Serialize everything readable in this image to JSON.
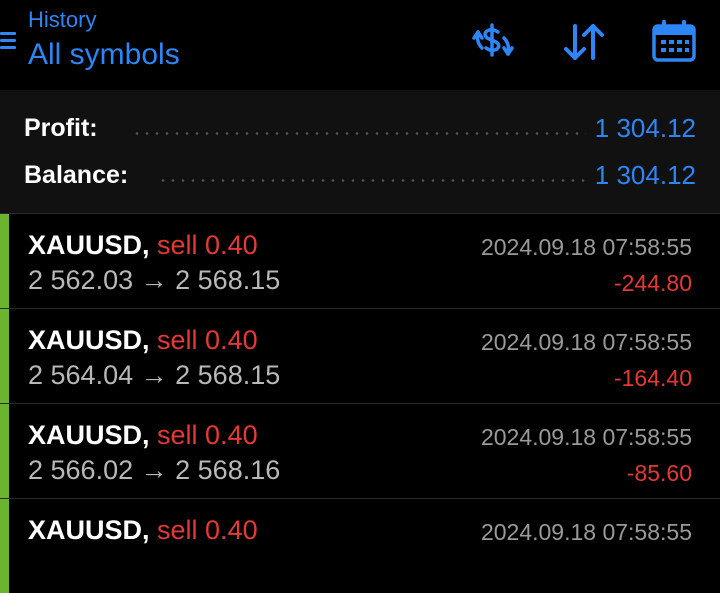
{
  "header": {
    "subtitle": "History",
    "title": "All symbols",
    "accent_color": "#2e86f5",
    "icons": [
      "menu-icon",
      "dollar-exchange-icon",
      "sort-icon",
      "calendar-icon"
    ]
  },
  "summary": {
    "profit_label": "Profit:",
    "profit_value": "1 304.12",
    "balance_label": "Balance:",
    "balance_value": "1 304.12"
  },
  "deals": [
    {
      "symbol": "XAUUSD,",
      "side": "sell 0.40",
      "open": "2 562.03",
      "arrow": "→",
      "close": "2 568.15",
      "time": "2024.09.18 07:58:55",
      "pl": "-244.80"
    },
    {
      "symbol": "XAUUSD,",
      "side": "sell 0.40",
      "open": "2 564.04",
      "arrow": "→",
      "close": "2 568.15",
      "time": "2024.09.18 07:58:55",
      "pl": "-164.40"
    },
    {
      "symbol": "XAUUSD,",
      "side": "sell 0.40",
      "open": "2 566.02",
      "arrow": "→",
      "close": "2 568.16",
      "time": "2024.09.18 07:58:55",
      "pl": "-85.60"
    },
    {
      "symbol": "XAUUSD,",
      "side": "sell 0.40",
      "open": "",
      "arrow": "",
      "close": "",
      "time": "2024.09.18 07:58:55",
      "pl": ""
    }
  ],
  "colors": {
    "loss": "#e53935",
    "buy_bar": "#6cb32e",
    "value": "#2e86f5"
  }
}
